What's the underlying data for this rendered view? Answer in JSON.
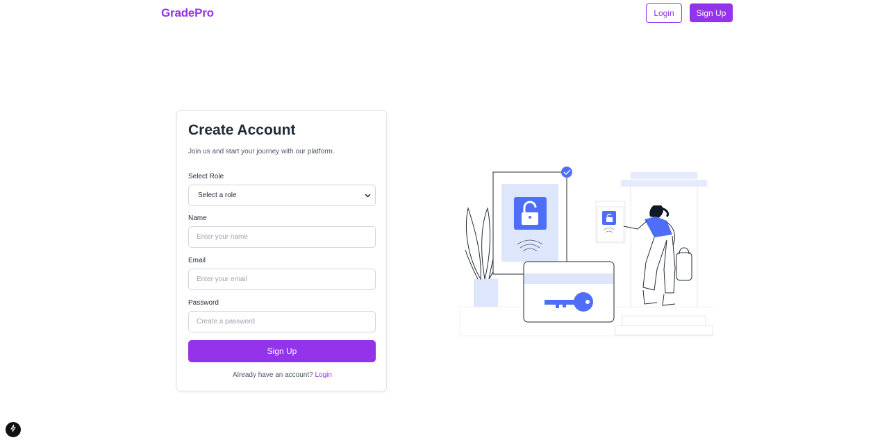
{
  "header": {
    "logo": "GradePro",
    "login_label": "Login",
    "signup_label": "Sign Up"
  },
  "form": {
    "title": "Create Account",
    "subtitle": "Join us and start your journey with our platform.",
    "role": {
      "label": "Select Role",
      "value": "Select a role"
    },
    "name": {
      "label": "Name",
      "placeholder": "Enter your name"
    },
    "email": {
      "label": "Email",
      "placeholder": "Enter your email"
    },
    "password": {
      "label": "Password",
      "placeholder": "Create a password"
    },
    "submit_label": "Sign Up",
    "footer_text": "Already have an account?",
    "footer_link": "Login"
  },
  "colors": {
    "brand": "#9333ea",
    "illustration_accent": "#4f6ef7",
    "illustration_light": "#dde6fb"
  },
  "icons": {
    "illustration": "security-unlock-illustration",
    "dev_badge": "lightning-icon"
  }
}
